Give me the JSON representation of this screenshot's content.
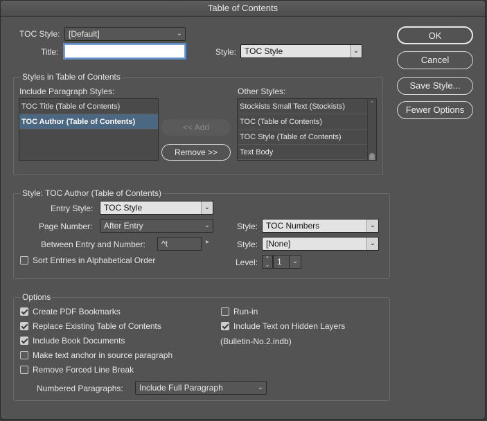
{
  "window": {
    "title": "Table of Contents"
  },
  "top": {
    "toc_style_label": "TOC Style:",
    "toc_style_value": "[Default]",
    "title_label": "Title:",
    "title_value": "",
    "style_label": "Style:",
    "style_value": "TOC Style"
  },
  "buttons": {
    "ok": "OK",
    "cancel": "Cancel",
    "save_style": "Save Style...",
    "fewer_options": "Fewer Options",
    "add": "<< Add",
    "remove": "Remove >>"
  },
  "styles_group": {
    "title": "Styles in Table of Contents",
    "include_label": "Include Paragraph Styles:",
    "include_items": [
      "TOC Title (Table of Contents)",
      "TOC Author (Table of Contents)"
    ],
    "other_label": "Other Styles:",
    "other_items": [
      "Stockists Small Text (Stockists)",
      "TOC (Table of Contents)",
      "TOC Style (Table of Contents)",
      "Text Body"
    ]
  },
  "style_group": {
    "title": "Style: TOC Author (Table of Contents)",
    "entry_style_label": "Entry Style:",
    "entry_style_value": "TOC Style",
    "page_number_label": "Page Number:",
    "page_number_value": "After Entry",
    "between_label": "Between Entry and Number:",
    "between_value": "^t",
    "sort_label": "Sort Entries in Alphabetical Order",
    "sort_checked": false,
    "style1_label": "Style:",
    "style1_value": "TOC Numbers",
    "style2_label": "Style:",
    "style2_value": "[None]",
    "level_label": "Level:",
    "level_value": "1"
  },
  "options_group": {
    "title": "Options",
    "create_pdf": {
      "label": "Create PDF Bookmarks",
      "checked": true
    },
    "replace_existing": {
      "label": "Replace Existing Table of Contents",
      "checked": true
    },
    "include_book": {
      "label": "Include Book Documents",
      "checked": true
    },
    "text_anchor": {
      "label": "Make text anchor in source paragraph",
      "checked": false
    },
    "remove_forced": {
      "label": "Remove Forced Line Break",
      "checked": false
    },
    "run_in": {
      "label": "Run-in",
      "checked": false
    },
    "hidden_layers": {
      "label": "Include Text on Hidden Layers",
      "checked": true
    },
    "book_file": "(Bulletin-No.2.indb)",
    "numbered_label": "Numbered Paragraphs:",
    "numbered_value": "Include Full Paragraph"
  },
  "icons": {
    "dropdown": "chevron-down-icon",
    "checkbox": "checkbox-icon",
    "stepper": "stepper-icon"
  }
}
